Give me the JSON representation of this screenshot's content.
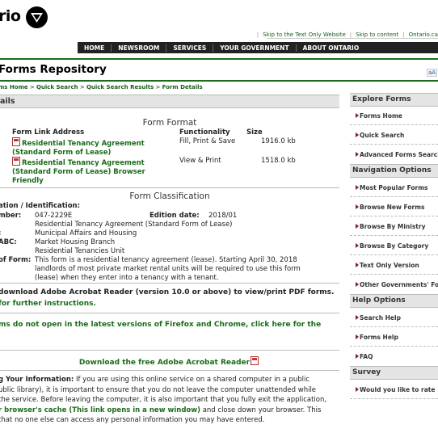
{
  "header": {
    "logo_text": "rio",
    "top_links": [
      "Skip to the Text Only Website",
      "Skip to content",
      "Ontario.ca"
    ],
    "nav": [
      "HOME",
      "NEWSROOM",
      "SERVICES",
      "YOUR GOVERNMENT",
      "ABOUT ONTARIO"
    ],
    "title": "Forms Repository",
    "text_size_label": "aA"
  },
  "breadcrumb": {
    "items": [
      "ms Home",
      "Quick Search",
      "Quick Search Results"
    ],
    "current": "Form Details",
    "sep": " > "
  },
  "details": {
    "heading": "ails",
    "format_heading": "Form Format",
    "col_link": "Form Link Address",
    "col_func": "Functionality",
    "col_size": "Size",
    "rows": [
      {
        "link": "Residential Tenancy Agreement (Standard Form of Lease)",
        "func": "Fill, Print & Save",
        "size": "1916.0 kb"
      },
      {
        "link": "Residential Tenancy Agreement (Standard Form of Lease) Browser Friendly",
        "func": "View & Print",
        "size": "1518.0 kb"
      }
    ],
    "class_heading": "Form Classification",
    "class_ident": "ation / Identification:",
    "number_label": "mber:",
    "number": "047-2229E",
    "edition_label": "Edition date:",
    "edition": "2018/01",
    "form_name": "Residential Tenancy Agreement (Standard Form of Lease)",
    "ministry_label": ":",
    "ministry": "Municipal Affairs and Housing",
    "abc_label": "ABC:",
    "branch": "Market Housing Branch",
    "unit": "Residential Tenancies Unit",
    "desc_label": "of Form:",
    "description": "This form is a residential tenancy agreement (lease). Starting April 30, 2018 landlords of most private market rental units will be required to use this form (lease) when they enter into a tenancy with a tenant."
  },
  "notes": {
    "acrobat_line1": "download Adobe Acrobat Reader (version 10.0 or above) to view/print PDF forms.",
    "acrobat_line2": " for further instructions.",
    "firefox_line1": "ms do not open in the latest versions of Firefox and Chrome, click here for the",
    "download_link": "Download the free Adobe Acrobat Reader"
  },
  "privacy": {
    "bold_start": "g Your Information:",
    "text1": " If you are using this online service on a shared computer in a public",
    "text2": "ublic library), it is important to ensure that you do not leave the computer unattended while",
    "text3": "the service. Before leaving the computer, it is also important that you fully exit the application,",
    "link_text": "r browser's cache (This link opens in a new window)",
    "text4": " and close down your browser. This",
    "text5": "that no one else can access any personal information you may have entered."
  },
  "sidebar": {
    "sections": [
      {
        "heading": "Explore Forms",
        "items": [
          "Forms Home",
          "Quick Search",
          "Advanced Forms Search"
        ]
      },
      {
        "heading": "Navigation Options",
        "items": [
          "Most Popular Forms",
          "Browse New Forms",
          "Browse By Ministry",
          "Browse By Category",
          "Text Only Version",
          "Other Governments' Forms"
        ]
      },
      {
        "heading": "Help Options",
        "items": [
          "Search Help",
          "Forms Help",
          "FAQ"
        ]
      },
      {
        "heading": "Survey",
        "items": [
          "Would you like to rate"
        ]
      }
    ]
  },
  "colors": {
    "accent_green": "#1a6b1a",
    "nav_bg": "#222222",
    "bar_gray": "#e4e4e4"
  }
}
